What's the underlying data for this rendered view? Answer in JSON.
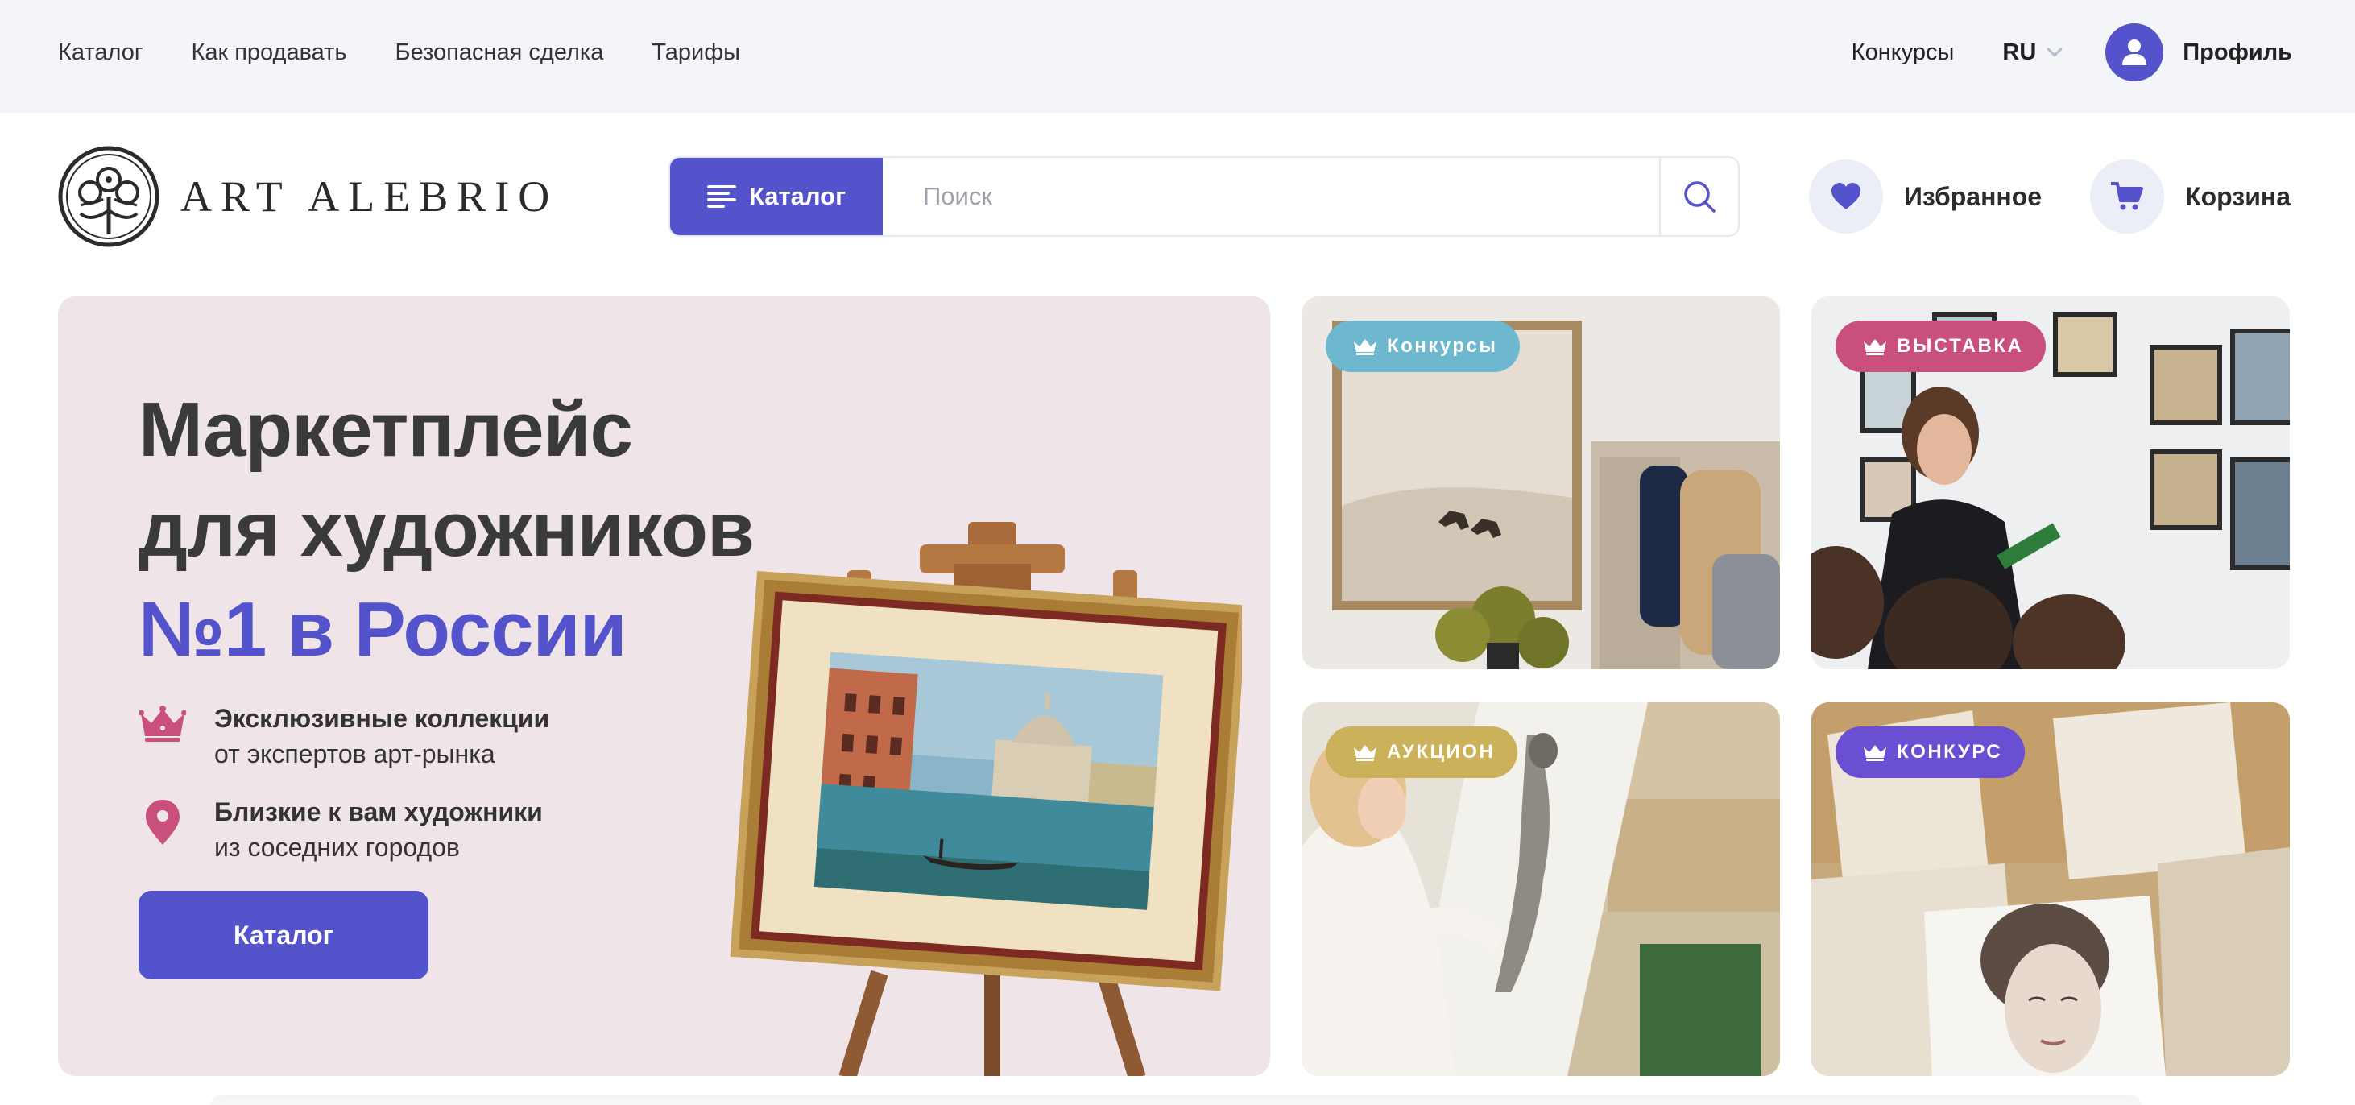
{
  "topnav": {
    "items": [
      "Каталог",
      "Как продавать",
      "Безопасная сделка",
      "Тарифы"
    ],
    "contests": "Конкурсы",
    "language": "RU",
    "profile": "Профиль"
  },
  "header": {
    "logo_text": "ART ALEBRIO",
    "catalog_button": "Каталог",
    "search_placeholder": "Поиск",
    "favorites": "Избранное",
    "cart": "Корзина"
  },
  "hero": {
    "title_line1": "Маркетплейс",
    "title_line2": "для художников",
    "title_line3": "№1 в России",
    "feature1_bold": "Эксклюзивные коллекции",
    "feature1_text": "от экспертов арт-рынка",
    "feature2_bold": "Близкие к вам художники",
    "feature2_text": "из соседних городов",
    "button": "Каталог"
  },
  "cards": [
    {
      "badge": "Конкурсы",
      "badge_color": "#6db7cf"
    },
    {
      "badge": "ВЫСТАВКА",
      "badge_color": "#c94f7c"
    },
    {
      "badge": "АУКЦИОН",
      "badge_color": "#cbb25a"
    },
    {
      "badge": "КОНКУРС",
      "badge_color": "#6a4fd3"
    }
  ],
  "colors": {
    "accent": "#5553cc",
    "hero_bg": "#efe5e9",
    "icon_pink": "#c94f7c"
  }
}
